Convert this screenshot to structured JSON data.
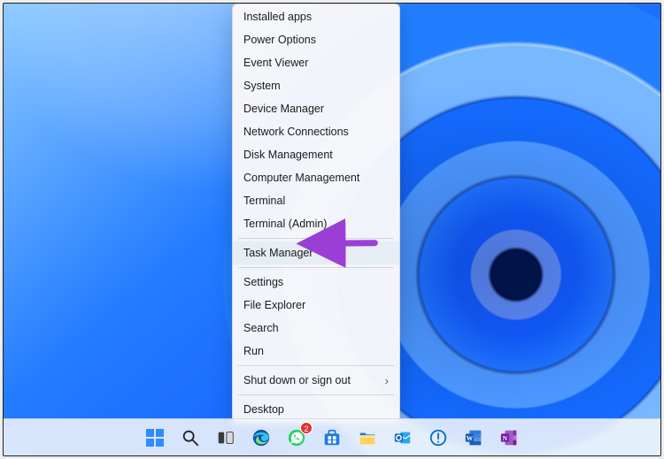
{
  "menu": {
    "groups": [
      [
        "Installed apps",
        "Power Options",
        "Event Viewer",
        "System",
        "Device Manager",
        "Network Connections",
        "Disk Management",
        "Computer Management",
        "Terminal",
        "Terminal (Admin)"
      ],
      [
        "Task Manager"
      ],
      [
        "Settings",
        "File Explorer",
        "Search",
        "Run"
      ],
      [
        "Shut down or sign out"
      ],
      [
        "Desktop"
      ]
    ],
    "highlighted": "Task Manager",
    "submenu_items": [
      "Shut down or sign out"
    ]
  },
  "annotation": {
    "arrow_color": "#9b3ed6"
  },
  "taskbar": {
    "items": [
      {
        "name": "start-button",
        "kind": "win11"
      },
      {
        "name": "search-button",
        "kind": "search"
      },
      {
        "name": "task-view-button",
        "kind": "taskview"
      },
      {
        "name": "edge-app",
        "kind": "edge"
      },
      {
        "name": "whatsapp-app",
        "kind": "whatsapp",
        "badge": "2"
      },
      {
        "name": "microsoft-store-app",
        "kind": "store"
      },
      {
        "name": "file-explorer-app",
        "kind": "explorer"
      },
      {
        "name": "outlook-app",
        "kind": "outlook"
      },
      {
        "name": "quick-assist-app",
        "kind": "assist"
      },
      {
        "name": "word-app",
        "kind": "word"
      },
      {
        "name": "onenote-app",
        "kind": "onenote"
      }
    ]
  }
}
